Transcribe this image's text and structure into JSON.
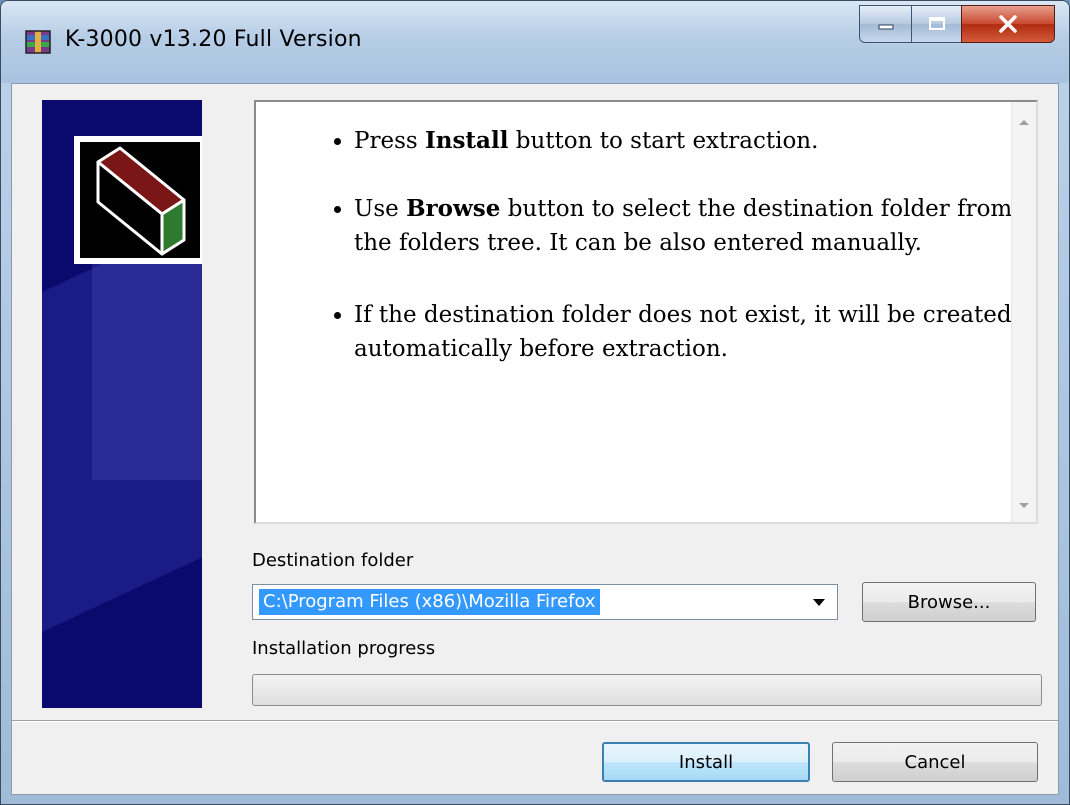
{
  "window": {
    "title": "K-3000 v13.20 Full Version",
    "minimize_icon": "minimize-icon",
    "maximize_icon": "maximize-icon",
    "close_icon": "close-icon",
    "app_icon": "winrar-archive-icon"
  },
  "banner": {
    "logo_icon": "sfx-box-logo-icon",
    "background_color": "#0a0a6e"
  },
  "info": {
    "bullet1_pre": "Press ",
    "bullet1_bold": "Install",
    "bullet1_post": " button to start extraction.",
    "bullet2_pre": "Use ",
    "bullet2_bold": "Browse",
    "bullet2_post": " button to select the destination folder from the folders tree. It can be also entered manually.",
    "bullet3": "If the destination folder does not exist, it will be created automatically before extraction."
  },
  "destination": {
    "label": "Destination folder",
    "value": "C:\\Program Files (x86)\\Mozilla Firefox",
    "dropdown_icon": "chevron-down-icon"
  },
  "buttons": {
    "browse": "Browse...",
    "install": "Install",
    "cancel": "Cancel"
  },
  "progress": {
    "label": "Installation progress",
    "value_percent": 0
  },
  "colors": {
    "selection": "#3399ff",
    "close_button": "#c9482e"
  }
}
